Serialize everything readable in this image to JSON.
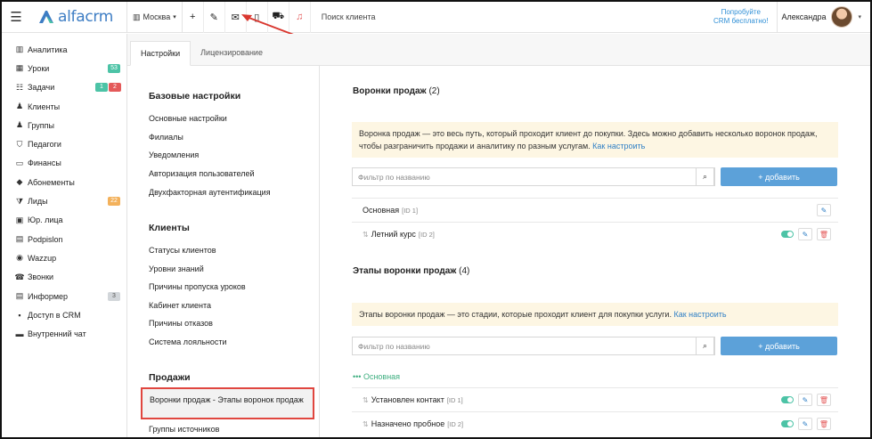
{
  "app": {
    "brand": "alfacrm"
  },
  "topbar": {
    "city": "Москва",
    "search_placeholder": "Поиск клиента",
    "promo_line1": "Попробуйте",
    "promo_line2": "CRM бесплатно!",
    "user_name": "Александра",
    "icons": [
      "menu-icon",
      "plus-icon",
      "wrench-icon",
      "envelope-icon",
      "phone-icon",
      "cart-icon",
      "bell-icon"
    ]
  },
  "sidebar": {
    "items": [
      {
        "label": "Аналитика",
        "icon": "chart-icon",
        "glyph": "▥"
      },
      {
        "label": "Уроки",
        "icon": "calendar-icon",
        "glyph": "▦",
        "badge": "53",
        "badge_color": "green"
      },
      {
        "label": "Задачи",
        "icon": "tasks-icon",
        "glyph": "☷",
        "badge": "1",
        "badge_color": "green",
        "badge2": "2",
        "badge2_color": "red"
      },
      {
        "label": "Клиенты",
        "icon": "user-icon",
        "glyph": "♟"
      },
      {
        "label": "Группы",
        "icon": "group-icon",
        "glyph": "♟"
      },
      {
        "label": "Педагоги",
        "icon": "graduation-icon",
        "glyph": "⛉"
      },
      {
        "label": "Финансы",
        "icon": "money-icon",
        "glyph": "▭"
      },
      {
        "label": "Абонементы",
        "icon": "tag-icon",
        "glyph": "◆"
      },
      {
        "label": "Лиды",
        "icon": "funnel-icon",
        "glyph": "⧩",
        "badge": "22",
        "badge_color": "orange"
      },
      {
        "label": "Юр. лица",
        "icon": "briefcase-icon",
        "glyph": "▣"
      },
      {
        "label": "Podpislon",
        "icon": "document-icon",
        "glyph": "▤"
      },
      {
        "label": "Wazzup",
        "icon": "whatsapp-icon",
        "glyph": "◉"
      },
      {
        "label": "Звонки",
        "icon": "phone-call-icon",
        "glyph": "☎"
      },
      {
        "label": "Информер",
        "icon": "informer-icon",
        "glyph": "▤",
        "badge": "3",
        "badge_color": "grey"
      },
      {
        "label": "Доступ в CRM",
        "icon": "lock-icon",
        "glyph": "▪"
      },
      {
        "label": "Внутренний чат",
        "icon": "chat-icon",
        "glyph": "▬"
      }
    ]
  },
  "tabs": [
    {
      "label": "Настройки",
      "active": true
    },
    {
      "label": "Лицензирование",
      "active": false
    }
  ],
  "settings_menu": {
    "sections": [
      {
        "title": "Базовые настройки",
        "items": [
          "Основные настройки",
          "Филиалы",
          "Уведомления",
          "Авторизация пользователей",
          "Двухфакторная аутентификация"
        ]
      },
      {
        "title": "Клиенты",
        "items": [
          "Статусы клиентов",
          "Уровни знаний",
          "Причины пропуска уроков",
          "Кабинет клиента",
          "Причины отказов",
          "Система лояльности"
        ]
      },
      {
        "title": "Продажи",
        "items": [
          "Воронки продаж - Этапы воронок продаж",
          "Группы источников"
        ]
      }
    ],
    "active_item": "Воронки продаж - Этапы воронок продаж"
  },
  "funnels": {
    "title": "Воронки продаж",
    "count": "(2)",
    "info_text": "Воронка продаж — это весь путь, который проходит клиент до покупки. Здесь можно добавить несколько воронок продаж, чтобы разграничить продажи и аналитику по разным услугам.",
    "info_link": "Как настроить",
    "filter_placeholder": "Фильтр по названию",
    "add_label": "+ добавить",
    "rows": [
      {
        "name": "Основная",
        "id": "[ID 1]",
        "draggable": false,
        "toggle": false,
        "delete": false
      },
      {
        "name": "Летний курс",
        "id": "[ID 2]",
        "draggable": true,
        "toggle": true,
        "delete": true
      }
    ]
  },
  "stages": {
    "title": "Этапы воронки продаж",
    "count": "(4)",
    "info_text": "Этапы воронки продаж — это стадии, которые проходит клиент для покупки услуги.",
    "info_link": "Как настроить",
    "filter_placeholder": "Фильтр по названию",
    "add_label": "+ добавить",
    "group_label": "••• Основная",
    "rows": [
      {
        "name": "Установлен контакт",
        "id": "[ID 1]"
      },
      {
        "name": "Назначено пробное",
        "id": "[ID 2]"
      }
    ]
  },
  "colors": {
    "accent": "#5ca1d9",
    "brand": "#3d7dc4",
    "highlight": "#e0463f",
    "success": "#4cc3a6"
  }
}
